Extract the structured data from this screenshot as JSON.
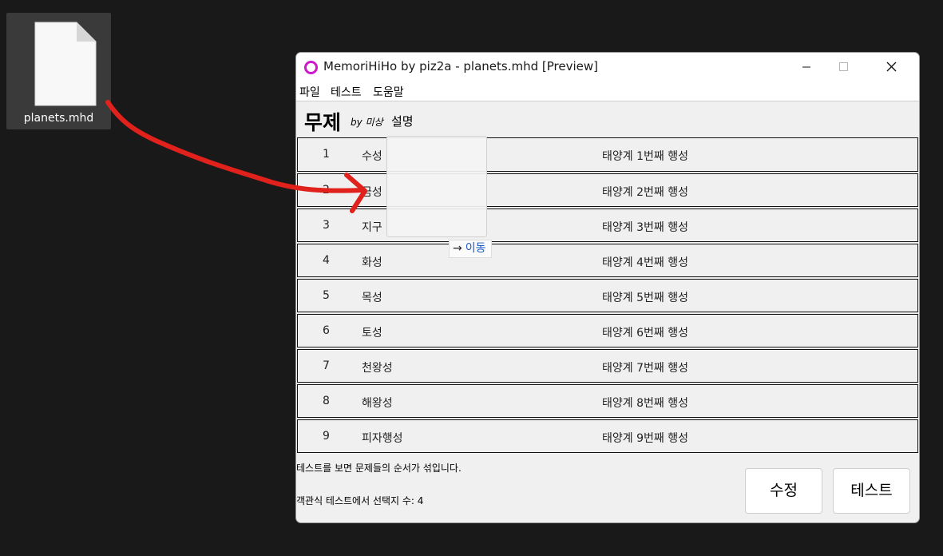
{
  "desktop": {
    "file_icon": "document-file-icon",
    "file_label": "planets.mhd"
  },
  "window": {
    "title": "MemoriHiHo by piz2a - planets.mhd [Preview]",
    "app_icon": "app-ring-icon",
    "controls": {
      "minimize": "minimize-icon",
      "maximize": "maximize-icon",
      "close": "close-icon"
    },
    "accent_color": "#cc19cc"
  },
  "menu": [
    {
      "label": "파일"
    },
    {
      "label": "테스트"
    },
    {
      "label": "도움말"
    }
  ],
  "document": {
    "title": "무제",
    "author": "by 미상",
    "description_label": "설명"
  },
  "rows": [
    {
      "num": "1",
      "term": "수성",
      "definition": "태양계 1번째 행성"
    },
    {
      "num": "2",
      "term": "금성",
      "definition": "태양계 2번째 행성"
    },
    {
      "num": "3",
      "term": "지구",
      "definition": "태양계 3번째 행성"
    },
    {
      "num": "4",
      "term": "화성",
      "definition": "태양계 4번째 행성"
    },
    {
      "num": "5",
      "term": "목성",
      "definition": "태양계 5번째 행성"
    },
    {
      "num": "6",
      "term": "토성",
      "definition": "태양계 6번째 행성"
    },
    {
      "num": "7",
      "term": "천왕성",
      "definition": "태양계 7번째 행성"
    },
    {
      "num": "8",
      "term": "해왕성",
      "definition": "태양계 8번째 행성"
    },
    {
      "num": "9",
      "term": "피자행성",
      "definition": "태양계 9번째 행성"
    }
  ],
  "footer": {
    "note": "테스트를 보면 문제들의 순서가 섞입니다.",
    "choice_count": "객관식 테스트에서 선택지 수: 4",
    "edit_button": "수정",
    "test_button": "테스트"
  },
  "drag": {
    "tooltip": "이동",
    "tooltip_icon": "arrow-right-icon",
    "annotation_color": "#e0211c"
  }
}
